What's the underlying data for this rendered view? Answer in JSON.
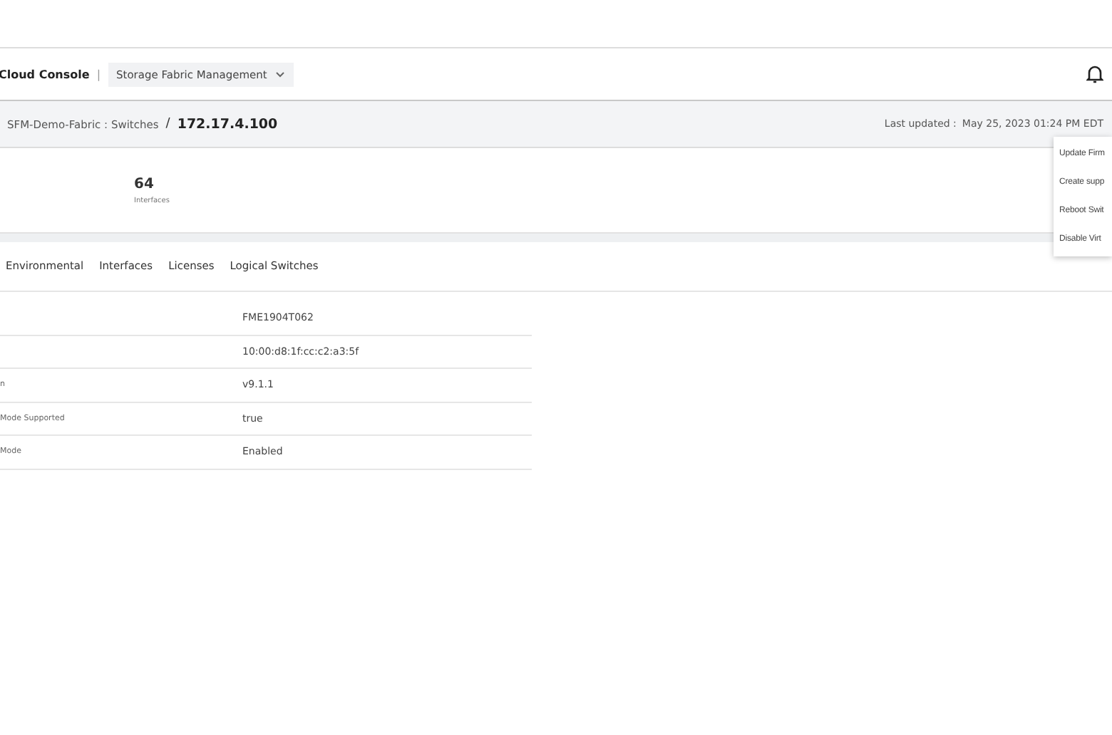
{
  "header": {
    "app_title": "Cloud Console",
    "separator": "|",
    "workspace": "Storage Fabric Management"
  },
  "breadcrumb": {
    "parent": "SFM-Demo-Fabric : Switches",
    "separator": "/",
    "current": "172.17.4.100",
    "last_updated_label": "Last updated :",
    "last_updated_value": "May 25, 2023 01:24 PM EDT"
  },
  "stats": [
    {
      "value": "64",
      "label": "Interfaces"
    }
  ],
  "tabs": [
    {
      "label": "Environmental",
      "selected": false
    },
    {
      "label": "Interfaces",
      "selected": false
    },
    {
      "label": "Licenses",
      "selected": false
    },
    {
      "label": "Logical Switches",
      "selected": false
    }
  ],
  "details": [
    {
      "value": "FME1904T062"
    },
    {
      "value": "10:00:d8:1f:cc:c2:a3:5f"
    },
    {
      "label": "n",
      "value": "v9.1.1"
    },
    {
      "label": "Mode Supported",
      "value": "true"
    },
    {
      "label": "Mode",
      "value": "Enabled"
    }
  ],
  "actions_menu": [
    "Update Firm",
    "Create supp",
    "Reboot Swit",
    "Disable Virt"
  ]
}
